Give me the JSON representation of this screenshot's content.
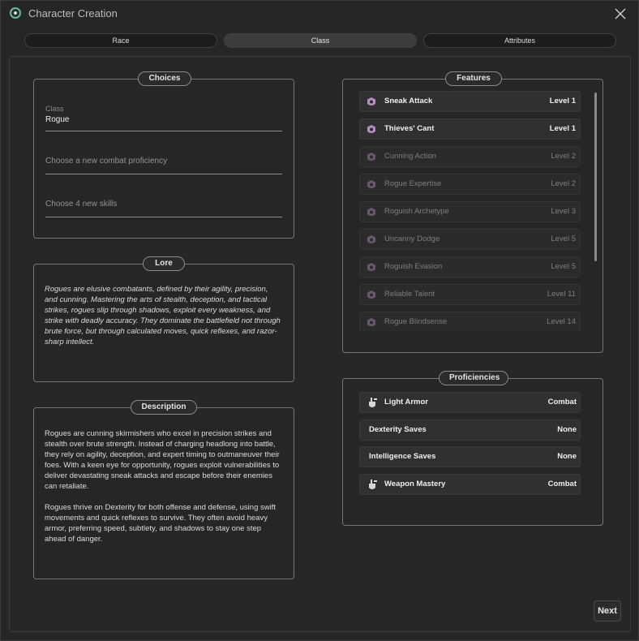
{
  "window": {
    "title": "Character Creation"
  },
  "tabs": [
    {
      "label": "Race",
      "active": false
    },
    {
      "label": "Class",
      "active": true
    },
    {
      "label": "Attributes",
      "active": false
    }
  ],
  "choices": {
    "label": "Choices",
    "class_caption": "Class",
    "class_value": "Rogue",
    "combat_placeholder": "Choose a new combat proficiency",
    "skills_placeholder": "Choose 4 new skills"
  },
  "lore": {
    "label": "Lore",
    "text": "Rogues are elusive combatants, defined by their agility, precision, and cunning.  Mastering the arts of stealth, deception, and tactical strikes, rogues slip through shadows, exploit every weakness, and strike with deadly accuracy. They dominate the battlefield not through brute force, but through calculated moves, quick reflexes, and razor-sharp intellect."
  },
  "description": {
    "label": "Description",
    "paragraphs": [
      "Rogues are cunning skirmishers who excel in precision strikes and stealth over brute strength. Instead of charging headlong into battle, they rely on agility, deception, and expert timing to outmaneuver their foes. With a keen eye for opportunity, rogues exploit vulnerabilities to deliver devastating sneak attacks and escape before their enemies can retaliate.",
      "Rogues thrive on Dexterity for both offense and defense, using swift movements and quick reflexes to survive. They often avoid heavy armor, preferring speed, subtlety, and shadows to stay one step ahead of danger."
    ]
  },
  "features": {
    "label": "Features",
    "items": [
      {
        "name": "Sneak Attack",
        "level": "Level 1",
        "unlocked": true
      },
      {
        "name": "Thieves' Cant",
        "level": "Level 1",
        "unlocked": true
      },
      {
        "name": "Cunning Action",
        "level": "Level 2",
        "unlocked": false
      },
      {
        "name": "Rogue Expertise",
        "level": "Level 2",
        "unlocked": false
      },
      {
        "name": "Roguish Archetype",
        "level": "Level 3",
        "unlocked": false
      },
      {
        "name": "Uncanny Dodge",
        "level": "Level 5",
        "unlocked": false
      },
      {
        "name": "Roguish Evasion",
        "level": "Level 5",
        "unlocked": false
      },
      {
        "name": "Reliable Talent",
        "level": "Level 11",
        "unlocked": false
      },
      {
        "name": "Rogue Blindsense",
        "level": "Level 14",
        "unlocked": false
      }
    ]
  },
  "proficiencies": {
    "label": "Proficiencies",
    "items": [
      {
        "name": "Light Armor",
        "type": "Combat",
        "icon": "armor-icon"
      },
      {
        "name": "Dexterity Saves",
        "type": "None",
        "icon": ""
      },
      {
        "name": "Intelligence Saves",
        "type": "None",
        "icon": ""
      },
      {
        "name": "Weapon Mastery",
        "type": "Combat",
        "icon": "weapon-icon"
      }
    ]
  },
  "footer": {
    "next_label": "Next"
  },
  "colors": {
    "accent_icon": "#b58fc2",
    "panel_border": "#767676"
  }
}
